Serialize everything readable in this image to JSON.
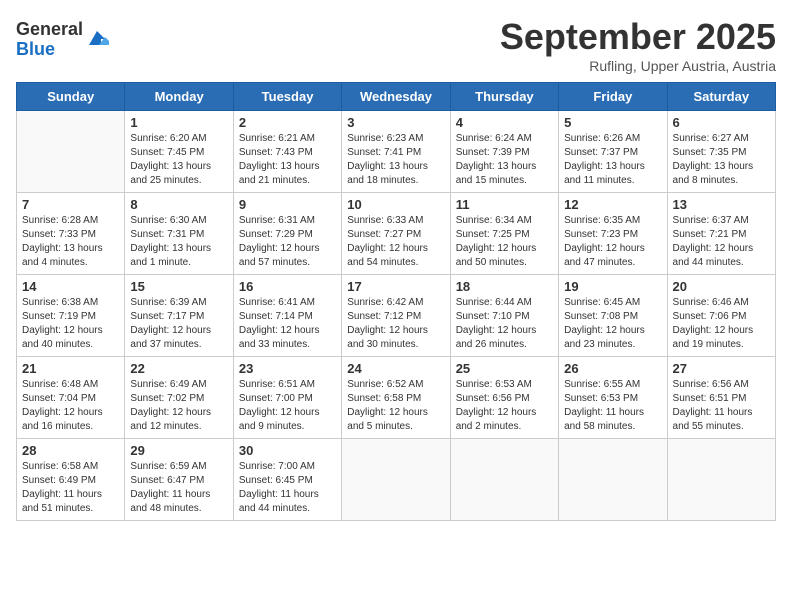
{
  "header": {
    "logo_general": "General",
    "logo_blue": "Blue",
    "title": "September 2025",
    "location": "Rufling, Upper Austria, Austria"
  },
  "calendar": {
    "days_of_week": [
      "Sunday",
      "Monday",
      "Tuesday",
      "Wednesday",
      "Thursday",
      "Friday",
      "Saturday"
    ],
    "weeks": [
      [
        {
          "day": "",
          "detail": ""
        },
        {
          "day": "1",
          "detail": "Sunrise: 6:20 AM\nSunset: 7:45 PM\nDaylight: 13 hours\nand 25 minutes."
        },
        {
          "day": "2",
          "detail": "Sunrise: 6:21 AM\nSunset: 7:43 PM\nDaylight: 13 hours\nand 21 minutes."
        },
        {
          "day": "3",
          "detail": "Sunrise: 6:23 AM\nSunset: 7:41 PM\nDaylight: 13 hours\nand 18 minutes."
        },
        {
          "day": "4",
          "detail": "Sunrise: 6:24 AM\nSunset: 7:39 PM\nDaylight: 13 hours\nand 15 minutes."
        },
        {
          "day": "5",
          "detail": "Sunrise: 6:26 AM\nSunset: 7:37 PM\nDaylight: 13 hours\nand 11 minutes."
        },
        {
          "day": "6",
          "detail": "Sunrise: 6:27 AM\nSunset: 7:35 PM\nDaylight: 13 hours\nand 8 minutes."
        }
      ],
      [
        {
          "day": "7",
          "detail": "Sunrise: 6:28 AM\nSunset: 7:33 PM\nDaylight: 13 hours\nand 4 minutes."
        },
        {
          "day": "8",
          "detail": "Sunrise: 6:30 AM\nSunset: 7:31 PM\nDaylight: 13 hours\nand 1 minute."
        },
        {
          "day": "9",
          "detail": "Sunrise: 6:31 AM\nSunset: 7:29 PM\nDaylight: 12 hours\nand 57 minutes."
        },
        {
          "day": "10",
          "detail": "Sunrise: 6:33 AM\nSunset: 7:27 PM\nDaylight: 12 hours\nand 54 minutes."
        },
        {
          "day": "11",
          "detail": "Sunrise: 6:34 AM\nSunset: 7:25 PM\nDaylight: 12 hours\nand 50 minutes."
        },
        {
          "day": "12",
          "detail": "Sunrise: 6:35 AM\nSunset: 7:23 PM\nDaylight: 12 hours\nand 47 minutes."
        },
        {
          "day": "13",
          "detail": "Sunrise: 6:37 AM\nSunset: 7:21 PM\nDaylight: 12 hours\nand 44 minutes."
        }
      ],
      [
        {
          "day": "14",
          "detail": "Sunrise: 6:38 AM\nSunset: 7:19 PM\nDaylight: 12 hours\nand 40 minutes."
        },
        {
          "day": "15",
          "detail": "Sunrise: 6:39 AM\nSunset: 7:17 PM\nDaylight: 12 hours\nand 37 minutes."
        },
        {
          "day": "16",
          "detail": "Sunrise: 6:41 AM\nSunset: 7:14 PM\nDaylight: 12 hours\nand 33 minutes."
        },
        {
          "day": "17",
          "detail": "Sunrise: 6:42 AM\nSunset: 7:12 PM\nDaylight: 12 hours\nand 30 minutes."
        },
        {
          "day": "18",
          "detail": "Sunrise: 6:44 AM\nSunset: 7:10 PM\nDaylight: 12 hours\nand 26 minutes."
        },
        {
          "day": "19",
          "detail": "Sunrise: 6:45 AM\nSunset: 7:08 PM\nDaylight: 12 hours\nand 23 minutes."
        },
        {
          "day": "20",
          "detail": "Sunrise: 6:46 AM\nSunset: 7:06 PM\nDaylight: 12 hours\nand 19 minutes."
        }
      ],
      [
        {
          "day": "21",
          "detail": "Sunrise: 6:48 AM\nSunset: 7:04 PM\nDaylight: 12 hours\nand 16 minutes."
        },
        {
          "day": "22",
          "detail": "Sunrise: 6:49 AM\nSunset: 7:02 PM\nDaylight: 12 hours\nand 12 minutes."
        },
        {
          "day": "23",
          "detail": "Sunrise: 6:51 AM\nSunset: 7:00 PM\nDaylight: 12 hours\nand 9 minutes."
        },
        {
          "day": "24",
          "detail": "Sunrise: 6:52 AM\nSunset: 6:58 PM\nDaylight: 12 hours\nand 5 minutes."
        },
        {
          "day": "25",
          "detail": "Sunrise: 6:53 AM\nSunset: 6:56 PM\nDaylight: 12 hours\nand 2 minutes."
        },
        {
          "day": "26",
          "detail": "Sunrise: 6:55 AM\nSunset: 6:53 PM\nDaylight: 11 hours\nand 58 minutes."
        },
        {
          "day": "27",
          "detail": "Sunrise: 6:56 AM\nSunset: 6:51 PM\nDaylight: 11 hours\nand 55 minutes."
        }
      ],
      [
        {
          "day": "28",
          "detail": "Sunrise: 6:58 AM\nSunset: 6:49 PM\nDaylight: 11 hours\nand 51 minutes."
        },
        {
          "day": "29",
          "detail": "Sunrise: 6:59 AM\nSunset: 6:47 PM\nDaylight: 11 hours\nand 48 minutes."
        },
        {
          "day": "30",
          "detail": "Sunrise: 7:00 AM\nSunset: 6:45 PM\nDaylight: 11 hours\nand 44 minutes."
        },
        {
          "day": "",
          "detail": ""
        },
        {
          "day": "",
          "detail": ""
        },
        {
          "day": "",
          "detail": ""
        },
        {
          "day": "",
          "detail": ""
        }
      ]
    ]
  }
}
